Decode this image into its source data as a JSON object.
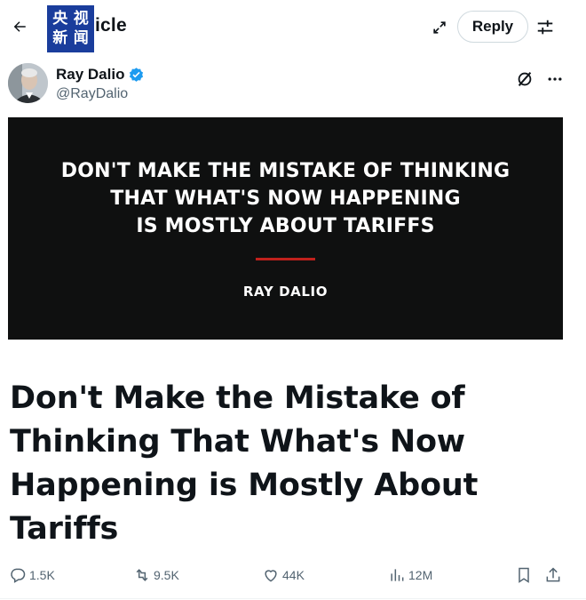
{
  "header": {
    "title": "icle",
    "logo_chars": [
      "央",
      "视",
      "新",
      "闻"
    ],
    "reply_label": "Reply",
    "back_icon": "back-arrow-icon",
    "expand_icon": "expand-icon",
    "settings_icon": "sliders-icon"
  },
  "author": {
    "name": "Ray Dalio",
    "handle": "@RayDalio",
    "verified": true,
    "verified_color": "#1d9bf0"
  },
  "hero_image": {
    "quote_lines": [
      "DON'T MAKE THE MISTAKE OF THINKING",
      "THAT WHAT'S NOW HAPPENING",
      "IS MOSTLY ABOUT TARIFFS"
    ],
    "author": "RAY DALIO",
    "background": "#0f1010",
    "accent": "#c0211c"
  },
  "article": {
    "title_lines": [
      "Don't Make the Mistake of",
      "Thinking That What's Now",
      "Happening is Mostly About",
      "Tariffs"
    ]
  },
  "actions": {
    "replies": "1.5K",
    "reposts": "9.5K",
    "likes": "44K",
    "views": "12M"
  }
}
